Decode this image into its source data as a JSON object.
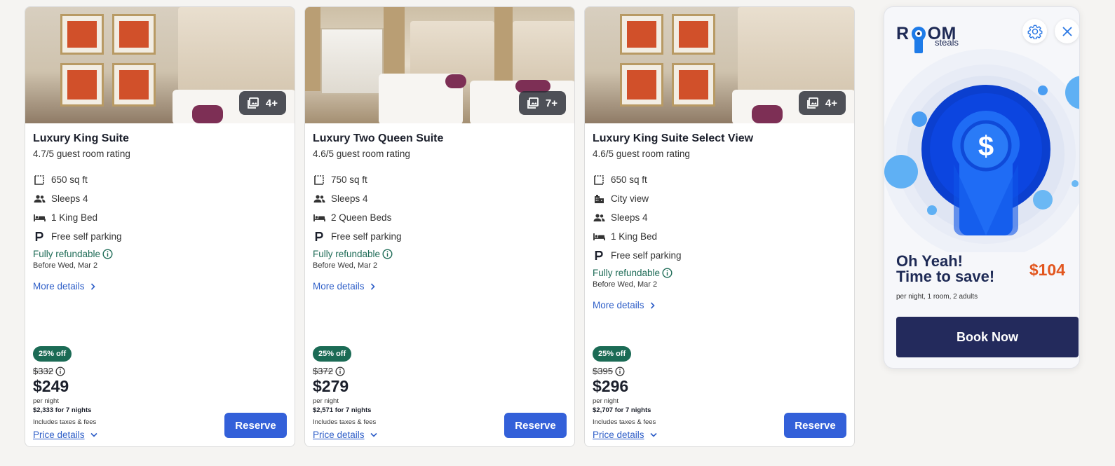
{
  "rooms": [
    {
      "photo_count": "4+",
      "title": "Luxury King Suite",
      "rating": "4.7/5 guest room rating",
      "amenities": [
        {
          "icon": "floor-plan-icon",
          "text": "650 sq ft"
        },
        {
          "icon": "people-icon",
          "text": "Sleeps 4"
        },
        {
          "icon": "bed-icon",
          "text": "1 King Bed"
        },
        {
          "icon": "parking-icon",
          "text": "Free self parking"
        }
      ],
      "refund": "Fully refundable",
      "refund_date": "Before Wed, Mar 2",
      "more_details": "More details",
      "discount": "25% off",
      "original_price": "$332",
      "price": "$249",
      "per_night": "per night",
      "total": "$2,333 for 7 nights",
      "taxes": "Includes taxes & fees",
      "price_details": "Price details",
      "reserve": "Reserve"
    },
    {
      "photo_count": "7+",
      "title": "Luxury Two Queen Suite",
      "rating": "4.6/5 guest room rating",
      "amenities": [
        {
          "icon": "floor-plan-icon",
          "text": "750 sq ft"
        },
        {
          "icon": "people-icon",
          "text": "Sleeps 4"
        },
        {
          "icon": "bed-icon",
          "text": "2 Queen Beds"
        },
        {
          "icon": "parking-icon",
          "text": "Free self parking"
        }
      ],
      "refund": "Fully refundable",
      "refund_date": "Before Wed, Mar 2",
      "more_details": "More details",
      "discount": "25% off",
      "original_price": "$372",
      "price": "$279",
      "per_night": "per night",
      "total": "$2,571 for 7 nights",
      "taxes": "Includes taxes & fees",
      "price_details": "Price details",
      "reserve": "Reserve"
    },
    {
      "photo_count": "4+",
      "title": "Luxury King Suite Select View",
      "rating": "4.6/5 guest room rating",
      "amenities": [
        {
          "icon": "floor-plan-icon",
          "text": "650 sq ft"
        },
        {
          "icon": "building-icon",
          "text": "City view"
        },
        {
          "icon": "people-icon",
          "text": "Sleeps 4"
        },
        {
          "icon": "bed-icon",
          "text": "1 King Bed"
        },
        {
          "icon": "parking-icon",
          "text": "Free self parking"
        }
      ],
      "refund": "Fully refundable",
      "refund_date": "Before Wed, Mar 2",
      "more_details": "More details",
      "discount": "25% off",
      "original_price": "$395",
      "price": "$296",
      "per_night": "per night",
      "total": "$2,707 for 7 nights",
      "taxes": "Includes taxes & fees",
      "price_details": "Price details",
      "reserve": "Reserve"
    }
  ],
  "widget": {
    "logo_main_left": "R",
    "logo_main_right": "OM",
    "logo_sub": "steals",
    "headline_line1": "Oh Yeah!",
    "headline_line2": "Time to save!",
    "price": "$104",
    "subtext": "per night, 1 room, 2 adults",
    "book_button": "Book Now",
    "accent_color": "#e2561e",
    "brand_color": "#232a5c"
  },
  "colors": {
    "link": "#2f5fc8",
    "reserve_button": "#3360d9",
    "refund_green": "#1d6b56",
    "discount_badge": "#1b6b55"
  }
}
